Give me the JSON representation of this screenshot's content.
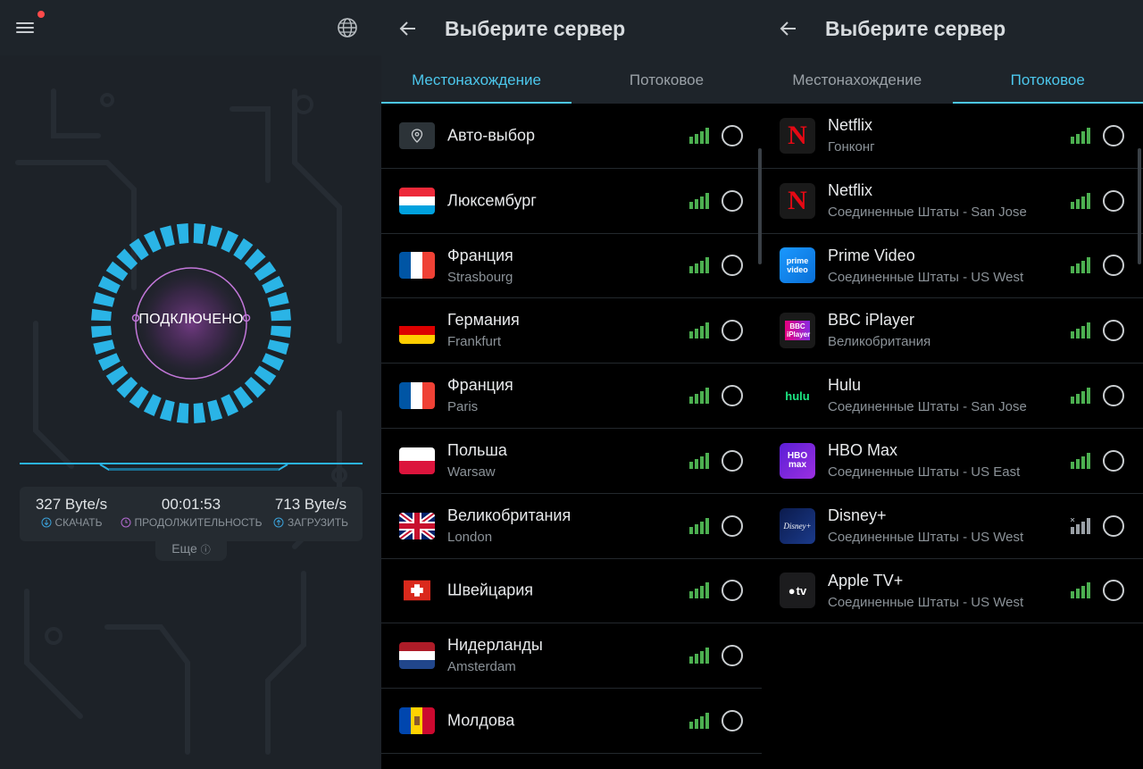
{
  "dashboard": {
    "status_text": "ПОДКЛЮЧЕНО",
    "download": {
      "value": "327 Byte/s",
      "label": "СКАЧАТЬ",
      "icon": "download-icon",
      "color": "#3aa0d8"
    },
    "duration": {
      "value": "00:01:53",
      "label": "ПРОДОЛЖИТЕЛЬНОСТЬ",
      "icon": "clock-icon",
      "color": "#b36ad1"
    },
    "upload": {
      "value": "713 Byte/s",
      "label": "ЗАГРУЗИТЬ",
      "icon": "upload-icon",
      "color": "#3aa0d8"
    },
    "more_label": "Еще",
    "accent": "#2ab4e6"
  },
  "locations_panel": {
    "title": "Выберите сервер",
    "tabs": [
      "Местонахождение",
      "Потоковое"
    ],
    "active_tab": 0,
    "items": [
      {
        "name": "Авто-выбор",
        "sub": "",
        "icon": "location-pin-icon"
      },
      {
        "name": "Люксембург",
        "sub": "",
        "icon": "flag-luxembourg-icon"
      },
      {
        "name": "Франция",
        "sub": "Strasbourg",
        "icon": "flag-france-icon"
      },
      {
        "name": "Германия",
        "sub": "Frankfurt",
        "icon": "flag-germany-icon"
      },
      {
        "name": "Франция",
        "sub": "Paris",
        "icon": "flag-france-icon"
      },
      {
        "name": "Польша",
        "sub": "Warsaw",
        "icon": "flag-poland-icon"
      },
      {
        "name": "Великобритания",
        "sub": "London",
        "icon": "flag-uk-icon"
      },
      {
        "name": "Швейцария",
        "sub": "",
        "icon": "flag-switzerland-icon"
      },
      {
        "name": "Нидерланды",
        "sub": "Amsterdam",
        "icon": "flag-netherlands-icon"
      },
      {
        "name": "Молдова",
        "sub": "",
        "icon": "flag-moldova-icon"
      }
    ]
  },
  "streaming_panel": {
    "title": "Выберите сервер",
    "tabs": [
      "Местонахождение",
      "Потоковое"
    ],
    "active_tab": 1,
    "items": [
      {
        "name": "Netflix",
        "sub": "Гонконг",
        "icon": "netflix-logo-icon",
        "logo_text": "N"
      },
      {
        "name": "Netflix",
        "sub": "Соединенные Штаты - San Jose",
        "icon": "netflix-logo-icon",
        "logo_text": "N"
      },
      {
        "name": "Prime Video",
        "sub": "Соединенные Штаты - US West",
        "icon": "prime-video-logo-icon",
        "logo_text": "prime video"
      },
      {
        "name": "BBC iPlayer",
        "sub": "Великобритания",
        "icon": "bbc-iplayer-logo-icon",
        "logo_text": "BBC iPlayer"
      },
      {
        "name": "Hulu",
        "sub": "Соединенные Штаты - San Jose",
        "icon": "hulu-logo-icon",
        "logo_text": "hulu"
      },
      {
        "name": "HBO Max",
        "sub": "Соединенные Штаты - US East",
        "icon": "hbo-max-logo-icon",
        "logo_text": "HBO max"
      },
      {
        "name": "Disney+",
        "sub": "Соединенные Штаты - US West",
        "icon": "disney-plus-logo-icon",
        "logo_text": "Disney+",
        "signal": "none"
      },
      {
        "name": "Apple TV+",
        "sub": "Соединенные Штаты - US West",
        "icon": "apple-tv-logo-icon",
        "logo_text": "tv"
      }
    ]
  },
  "colors": {
    "signal_green": "#4caf50",
    "signal_gray": "#9aa0a6",
    "tab_active": "#4cc7ec"
  }
}
